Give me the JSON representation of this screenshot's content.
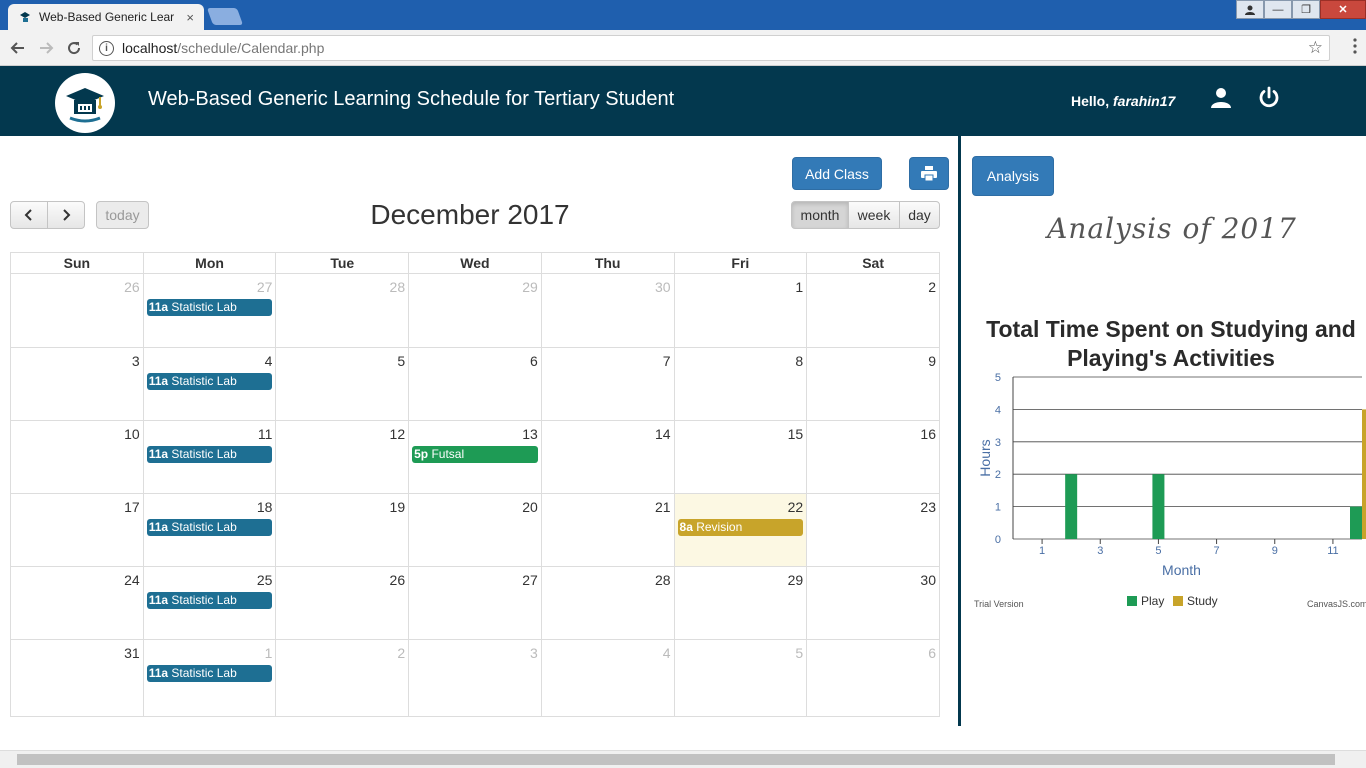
{
  "browser": {
    "tab_title": "Web-Based Generic Lear",
    "tab_close": "×",
    "url_host": "localhost",
    "url_path": "/schedule/Calendar.php",
    "win_min": "—",
    "win_max": "❐",
    "win_close": "✕"
  },
  "header": {
    "title": "Web-Based Generic Learning Schedule for Tertiary Student",
    "greeting": "Hello, ",
    "username": "farahin17"
  },
  "toolbar": {
    "add_class_label": "Add Class",
    "analysis_label": "Analysis",
    "today_label": "today",
    "month_label": "month",
    "week_label": "week",
    "day_label": "day"
  },
  "calendar": {
    "title": "December 2017",
    "weekdays": [
      "Sun",
      "Mon",
      "Tue",
      "Wed",
      "Thu",
      "Fri",
      "Sat"
    ],
    "weeks": [
      [
        {
          "d": "26",
          "o": true
        },
        {
          "d": "27",
          "o": true,
          "ev": {
            "time": "11a",
            "title": "Statistic Lab",
            "color": "#1e6f93"
          }
        },
        {
          "d": "28",
          "o": true
        },
        {
          "d": "29",
          "o": true
        },
        {
          "d": "30",
          "o": true
        },
        {
          "d": "1"
        },
        {
          "d": "2"
        }
      ],
      [
        {
          "d": "3"
        },
        {
          "d": "4",
          "ev": {
            "time": "11a",
            "title": "Statistic Lab",
            "color": "#1e6f93"
          }
        },
        {
          "d": "5"
        },
        {
          "d": "6"
        },
        {
          "d": "7"
        },
        {
          "d": "8"
        },
        {
          "d": "9"
        }
      ],
      [
        {
          "d": "10"
        },
        {
          "d": "11",
          "ev": {
            "time": "11a",
            "title": "Statistic Lab",
            "color": "#1e6f93"
          }
        },
        {
          "d": "12"
        },
        {
          "d": "13",
          "ev": {
            "time": "5p",
            "title": "Futsal",
            "color": "#1e9b55"
          }
        },
        {
          "d": "14"
        },
        {
          "d": "15"
        },
        {
          "d": "16"
        }
      ],
      [
        {
          "d": "17"
        },
        {
          "d": "18",
          "ev": {
            "time": "11a",
            "title": "Statistic Lab",
            "color": "#1e6f93"
          }
        },
        {
          "d": "19"
        },
        {
          "d": "20"
        },
        {
          "d": "21"
        },
        {
          "d": "22",
          "today": true,
          "ev": {
            "time": "8a",
            "title": "Revision",
            "color": "#c8a42a"
          }
        },
        {
          "d": "23"
        }
      ],
      [
        {
          "d": "24"
        },
        {
          "d": "25",
          "ev": {
            "time": "11a",
            "title": "Statistic Lab",
            "color": "#1e6f93"
          }
        },
        {
          "d": "26"
        },
        {
          "d": "27"
        },
        {
          "d": "28"
        },
        {
          "d": "29"
        },
        {
          "d": "30"
        }
      ],
      [
        {
          "d": "31"
        },
        {
          "d": "1",
          "o": true,
          "ev": {
            "time": "11a",
            "title": "Statistic Lab",
            "color": "#1e6f93"
          }
        },
        {
          "d": "2",
          "o": true
        },
        {
          "d": "3",
          "o": true
        },
        {
          "d": "4",
          "o": true
        },
        {
          "d": "5",
          "o": true
        },
        {
          "d": "6",
          "o": true
        }
      ]
    ]
  },
  "analysis": {
    "heading": "Analysis of 2017"
  },
  "chart_data": {
    "type": "bar",
    "title": "Total Time Spent on Studying and Playing's Activities",
    "xlabel": "Month",
    "ylabel": "Hours",
    "xlim": [
      0,
      12
    ],
    "ylim": [
      0,
      5
    ],
    "xticks": [
      1,
      3,
      5,
      7,
      9,
      11
    ],
    "yticks": [
      0,
      1,
      2,
      3,
      4,
      5
    ],
    "series": [
      {
        "name": "Play",
        "color": "#1e9b55",
        "points": [
          {
            "x": 2,
            "y": 2
          },
          {
            "x": 5,
            "y": 2
          },
          {
            "x": 12,
            "y": 1
          }
        ]
      },
      {
        "name": "Study",
        "color": "#c8a42a",
        "points": [
          {
            "x": 12,
            "y": 4
          }
        ]
      }
    ],
    "footer_left": "Trial Version",
    "footer_right": "CanvasJS.com",
    "legend": "bottom-center",
    "grid": true
  }
}
